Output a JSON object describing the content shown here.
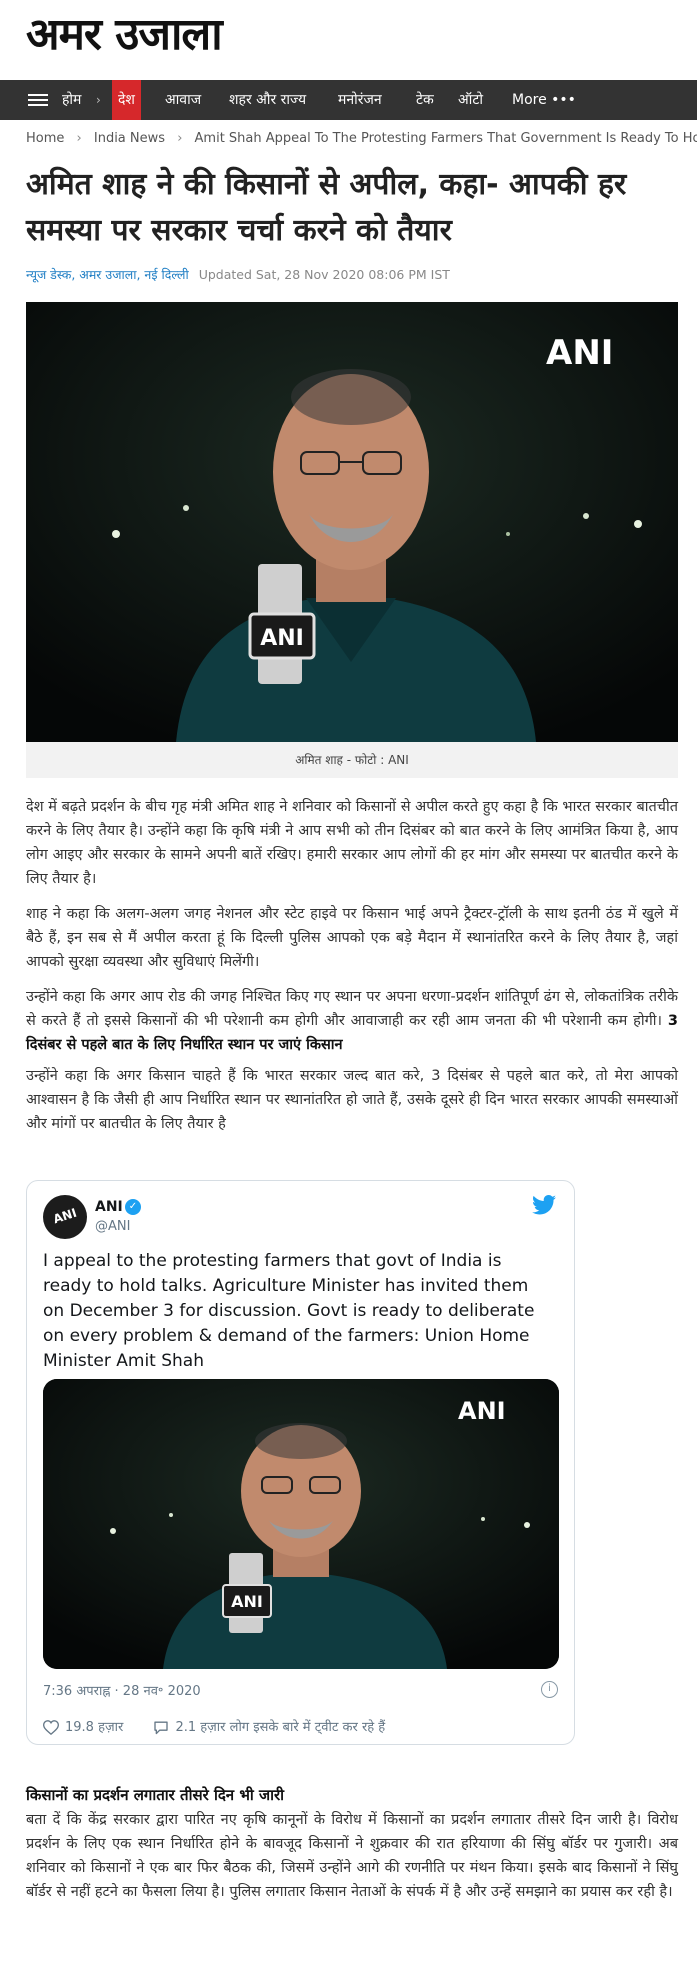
{
  "site": {
    "logo": "अमर उजाला"
  },
  "nav": {
    "items": [
      {
        "label": "होम"
      },
      {
        "label": "देश",
        "active": true
      },
      {
        "label": "आवाज"
      },
      {
        "label": "शहर और राज्य"
      },
      {
        "label": "मनोरंजन"
      },
      {
        "label": "टेक"
      },
      {
        "label": "ऑटो"
      },
      {
        "label": "More •••"
      }
    ],
    "accent": "#d6282b",
    "bar_color": "#333333"
  },
  "breadcrumb": {
    "items": [
      "Home",
      "India News",
      "Amit Shah Appeal To The Protesting Farmers That Government Is Ready To Hold Talks"
    ]
  },
  "article": {
    "title": "अमित शाह ने की किसानों से अपील, कहा- आपकी हर समस्या पर सरकार चर्चा करने को तैयार",
    "author": "न्यूज डेस्क, अमर उजाला, नई दिल्ली",
    "updated": "Updated Sat, 28 Nov 2020 08:06 PM IST",
    "hero": {
      "watermark": "ANI",
      "mic_label": "ANI"
    },
    "caption": "अमित शाह - फोटो : ANI",
    "paragraphs": [
      "देश में बढ़ते प्रदर्शन के बीच गृह मंत्री अमित शाह ने शनिवार को किसानों से अपील करते हुए कहा है कि भारत सरकार बातचीत करने के लिए तैयार है। उन्होंने कहा कि कृषि मंत्री ने आप सभी को तीन दिसंबर को बात करने के लिए आमंत्रित किया है, आप लोग आइए और सरकार के सामने अपनी बातें रखिए। हमारी सरकार आप लोगों की हर मांग और समस्या पर बातचीत करने के लिए तैयार है।",
      "शाह ने कहा कि अलग-अलग जगह नेशनल और स्टेट हाइवे पर किसान भाई अपने ट्रैक्टर-ट्रॉली के साथ इतनी ठंड में खुले में बैठे हैं, इन सब से मैं अपील करता हूं कि दिल्ली पुलिस आपको एक बड़े मैदान में स्थानांतरित करने के लिए तैयार है, जहां आपको सुरक्षा व्यवस्था और सुविधाएं मिलेंगी।",
      "उन्होंने कहा कि अगर आप रोड की जगह निश्चित किए गए स्थान पर अपना धरणा-प्रदर्शन शांतिपूर्ण ढंग से, लोकतांत्रिक तरीके से करते हैं तो इससे किसानों की भी परेशानी कम होगी और आवाजाही कर रही आम जनता की भी परेशानी कम होगी।",
      "उन्होंने कहा कि अगर किसान चाहते हैं कि भारत सरकार जल्द बात करे, 3 दिसंबर से पहले बात करे, तो मेरा आपको आश्वासन है कि जैसी ही आप निर्धारित स्थान पर स्थानांतरित हो जाते हैं, उसके दूसरे ही दिन भारत सरकार आपकी समस्याओं और मांगों पर बातचीत के लिए तैयार है"
    ],
    "inline_heading": "3 दिसंबर से पहले बात के लिए निर्धारित स्थान पर जाएं किसान",
    "subheading": "किसानों का प्रदर्शन लगातार तीसरे दिन भी जारी",
    "closing_paragraph": "बता दें कि केंद्र सरकार द्वारा पारित नए कृषि कानूनों के विरोध में किसानों का प्रदर्शन लगातार तीसरे दिन जारी है। विरोध प्रदर्शन के लिए एक स्थान निर्धारित होने के बावजूद किसानों ने शुक्रवार की रात हरियाणा की सिंघु बॉर्डर पर गुजारी। अब शनिवार को किसानों ने एक बार फिर बैठक की, जिसमें उन्होंने आगे की रणनीति पर मंथन किया। इसके बाद किसानों ने सिंघु बॉर्डर से नहीं हटने का फैसला लिया है। पुलिस लगातार किसान नेताओं के संपर्क में है और उन्हें समझाने का प्रयास कर रही है।"
  },
  "tweet": {
    "name": "ANI",
    "handle": "@ANI",
    "avatar_text": "ANI",
    "text": "I appeal to the protesting farmers that govt of India is ready to hold talks. Agriculture Minister has invited them on December 3 for discussion. Govt is ready to deliberate on every problem & demand of the farmers: Union Home Minister Amit Shah",
    "media": {
      "watermark": "ANI",
      "mic_label": "ANI"
    },
    "timestamp": "7:36 अपराह्न · 28 नव॰ 2020",
    "likes": "19.8 हज़ार",
    "replies": "2.1 हज़ार लोग इसके बारे में ट्वीट कर रहे हैं",
    "brand_color": "#1da1f2"
  }
}
